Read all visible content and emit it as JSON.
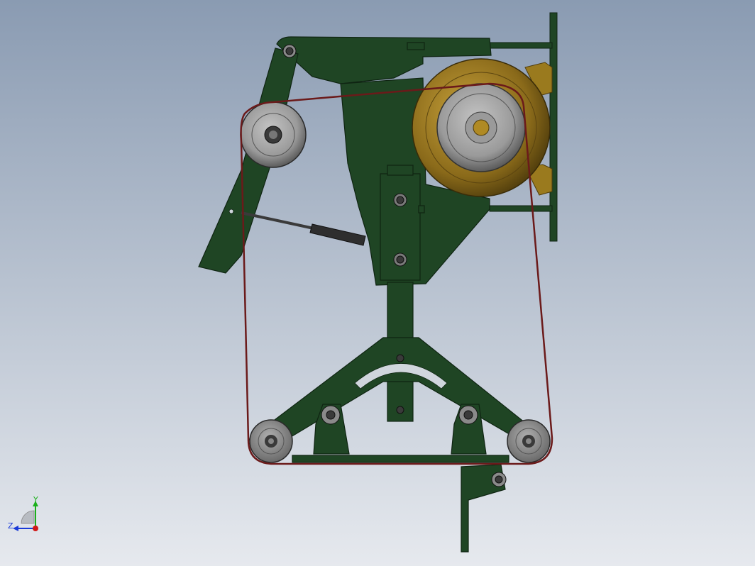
{
  "viewport": {
    "background_top": "#8a9bb2",
    "background_bottom": "#e6e9ee",
    "frame_color": "#1f4524",
    "frame_edge": "#0f2412",
    "belt_color": "#6b1a1a",
    "wheel_color": "#a9a9a9",
    "motor_color": "#9a7a1e"
  },
  "triad": {
    "y_label": "Y",
    "z_label": "Z",
    "x_color": "#d11818",
    "y_color": "#1cb01c",
    "z_color": "#1a3ad8"
  }
}
